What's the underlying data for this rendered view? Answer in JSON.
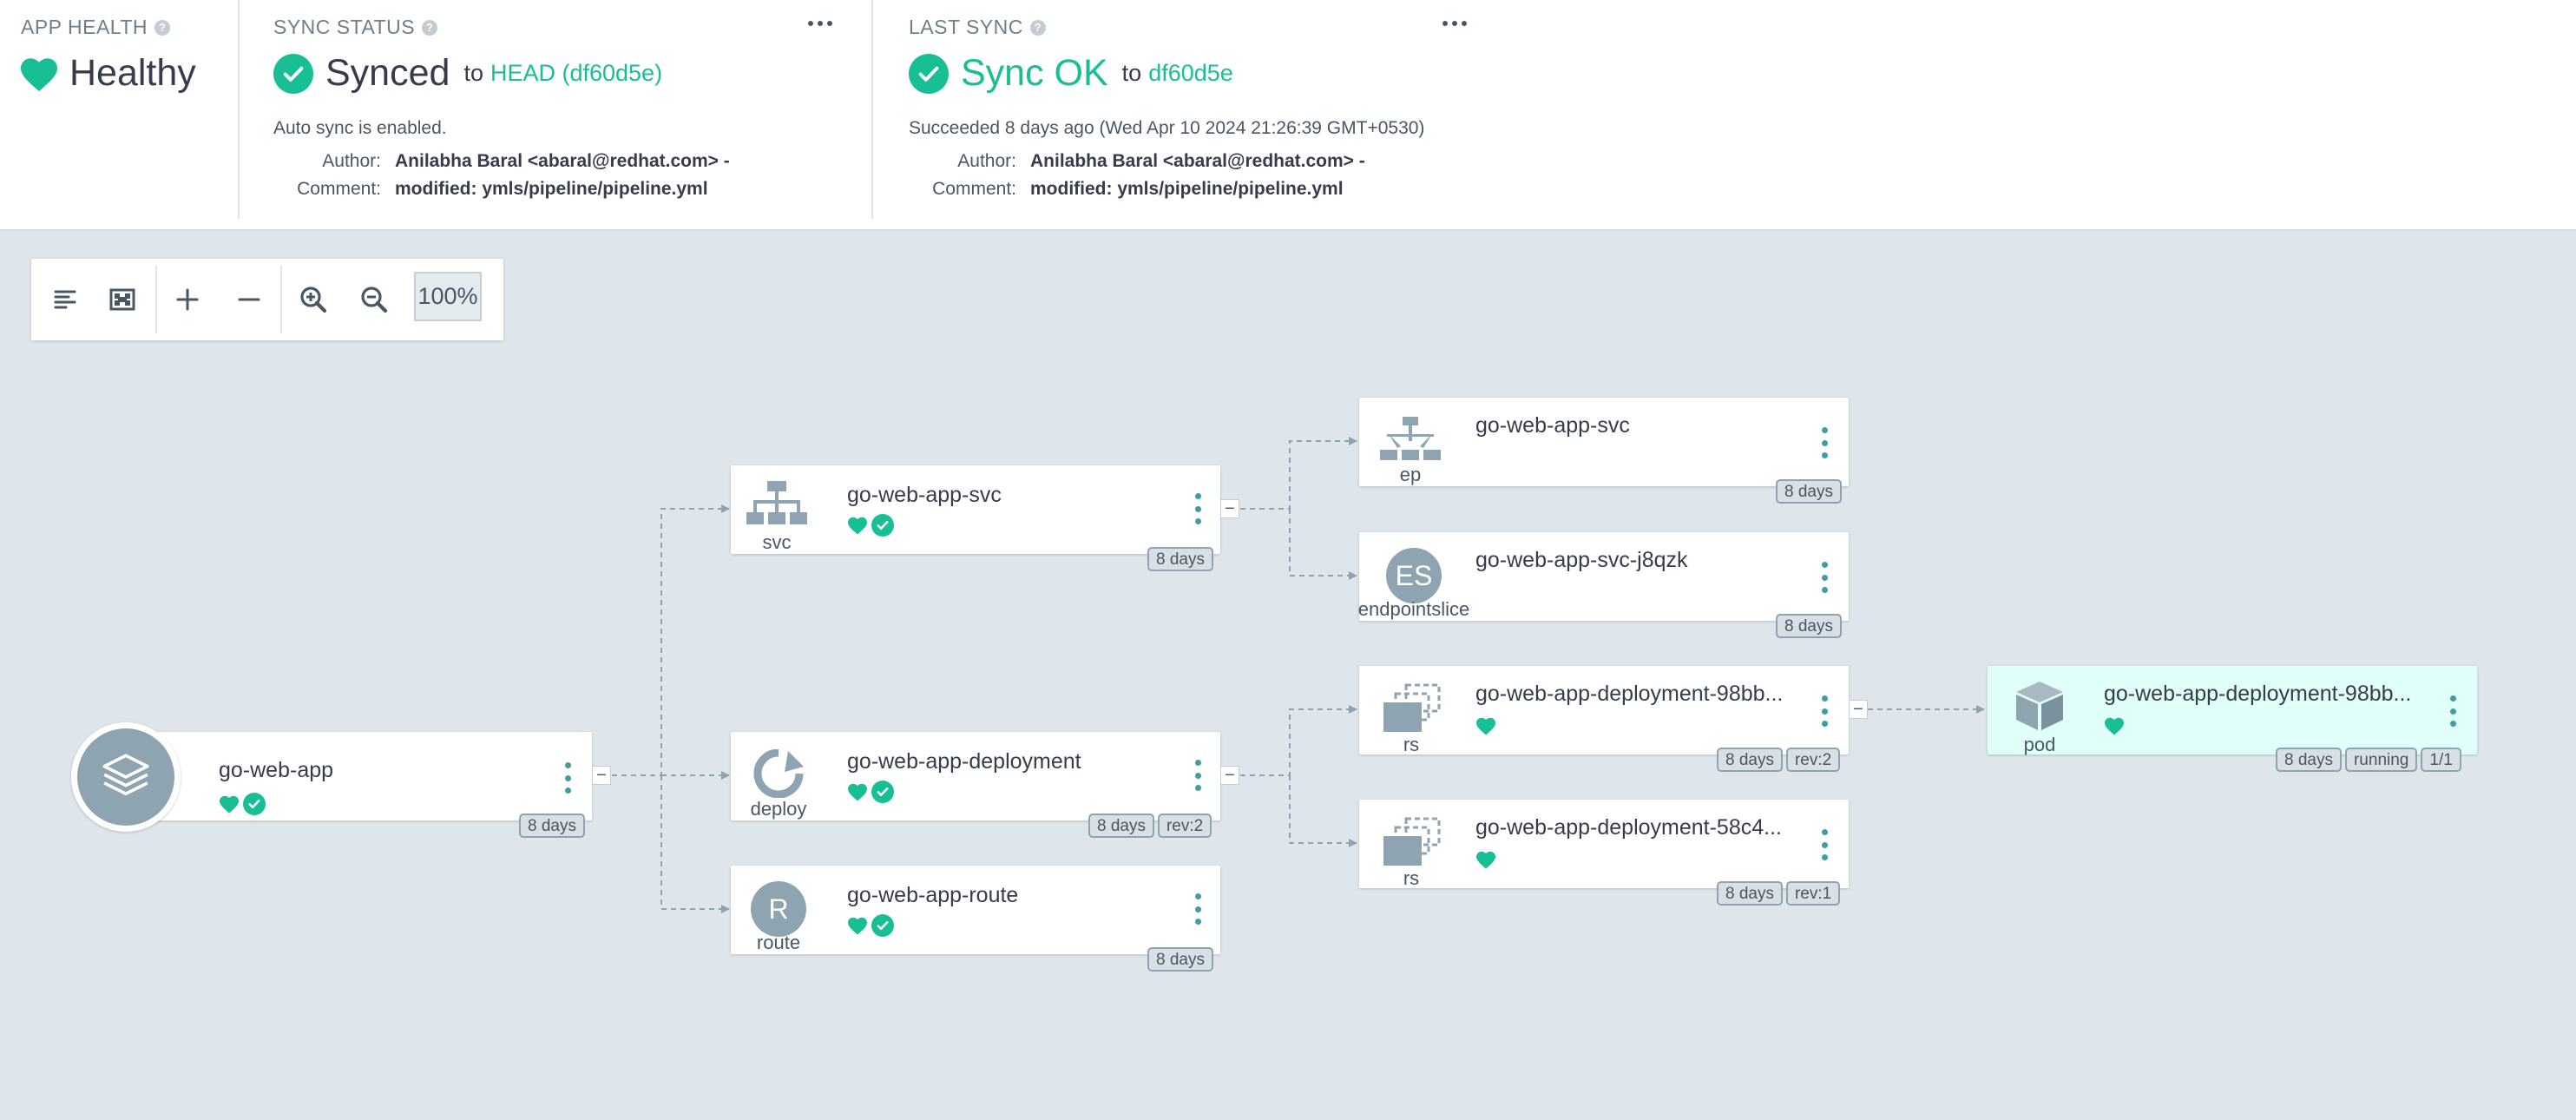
{
  "app_health": {
    "title": "APP HEALTH",
    "status": "Healthy"
  },
  "sync_status": {
    "title": "SYNC STATUS",
    "status": "Synced",
    "to_label": "to",
    "revision": "HEAD (df60d5e)",
    "auto_sync": "Auto sync is enabled.",
    "author_label": "Author:",
    "author": "Anilabha Baral <abaral@redhat.com> -",
    "comment_label": "Comment:",
    "comment": "modified: ymls/pipeline/pipeline.yml"
  },
  "last_sync": {
    "title": "LAST SYNC",
    "status": "Sync OK",
    "to_label": "to",
    "revision": "df60d5e",
    "succeeded": "Succeeded 8 days ago (Wed Apr 10 2024 21:26:39 GMT+0530)",
    "author_label": "Author:",
    "author": "Anilabha Baral <abaral@redhat.com> -",
    "comment_label": "Comment:",
    "comment": "modified: ymls/pipeline/pipeline.yml"
  },
  "toolbar": {
    "zoom": "100%"
  },
  "colors": {
    "healthy": "#18be94",
    "link": "#18be94",
    "icon_gray": "#8fa4b1",
    "kebab": "#3e9ea4",
    "canvas": "#dee6eb",
    "pod_bg": "#e0fff9"
  },
  "nodes": {
    "app": {
      "name": "go-web-app",
      "age": "8 days",
      "icon": "layers-icon"
    },
    "svc": {
      "name": "go-web-app-svc",
      "kind": "svc",
      "age": "8 days",
      "icon": "service-icon"
    },
    "deploy": {
      "name": "go-web-app-deployment",
      "kind": "deploy",
      "age": "8 days",
      "rev": "rev:2",
      "icon": "deploy-icon"
    },
    "route": {
      "name": "go-web-app-route",
      "kind": "route",
      "letter": "R",
      "age": "8 days"
    },
    "ep": {
      "name": "go-web-app-svc",
      "kind": "ep",
      "age": "8 days",
      "icon": "service-icon"
    },
    "eps": {
      "name": "go-web-app-svc-j8qzk",
      "kind": "endpointslice",
      "letter": "ES",
      "age": "8 days"
    },
    "rs1": {
      "name": "go-web-app-deployment-98bb...",
      "kind": "rs",
      "age": "8 days",
      "rev": "rev:2",
      "icon": "replicaset-icon"
    },
    "rs2": {
      "name": "go-web-app-deployment-58c4...",
      "kind": "rs",
      "age": "8 days",
      "rev": "rev:1",
      "icon": "replicaset-icon"
    },
    "pod": {
      "name": "go-web-app-deployment-98bb...",
      "kind": "pod",
      "age": "8 days",
      "state": "running",
      "ready": "1/1",
      "icon": "pod-cube-icon"
    }
  }
}
